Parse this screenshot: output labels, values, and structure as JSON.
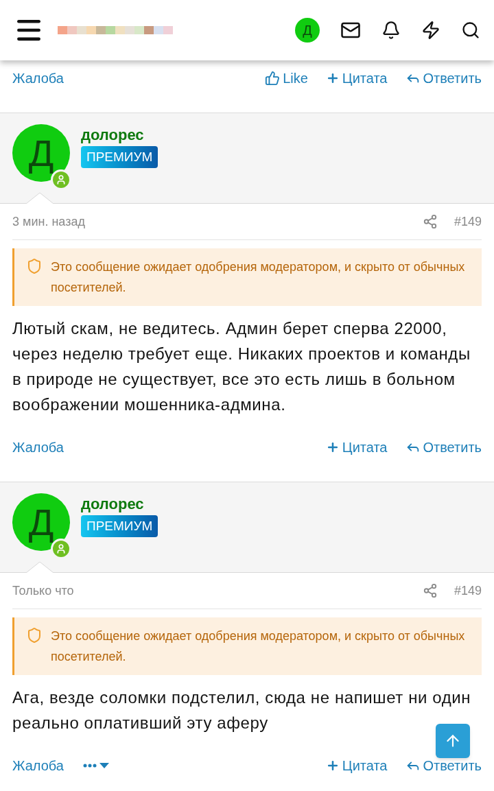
{
  "header": {
    "avatar_letter": "Д"
  },
  "top_actions": [
    {
      "kind": "report",
      "label": "Жалоба"
    },
    {
      "kind": "like",
      "label": "Like"
    },
    {
      "kind": "quote",
      "label": "Цитата"
    },
    {
      "kind": "reply",
      "label": "Ответить"
    }
  ],
  "posts": [
    {
      "author": "долорес",
      "badge": "ПРЕМИУМ",
      "avatar_letter": "Д",
      "time": "3 мин. назад",
      "number": "#149",
      "notice": "Это сообщение ожидает одобрения модератором, и скрыто от обычных посетителей.",
      "body": "Лютый скам, не ведитесь. Админ берет сперва 22000, через неделю требует еще. Никаких проектов и команды в природе не существует, все это есть лишь в больном воображении мошенника-админа.",
      "actions": [
        {
          "kind": "report",
          "label": "Жалоба"
        },
        {
          "kind": "quote",
          "label": "Цитата"
        },
        {
          "kind": "reply",
          "label": "Ответить"
        }
      ]
    },
    {
      "author": "долорес",
      "badge": "ПРЕМИУМ",
      "avatar_letter": "Д",
      "time": "Только что",
      "number": "#149",
      "notice": "Это сообщение ожидает одобрения модератором, и скрыто от обычных посетителей.",
      "body": "Ага, везде соломки подстелил, сюда не напишет ни один реально оплативший эту аферу",
      "actions": [
        {
          "kind": "report",
          "label": "Жалоба"
        },
        {
          "kind": "more"
        },
        {
          "kind": "quote",
          "label": "Цитата"
        },
        {
          "kind": "reply",
          "label": "Ответить"
        }
      ]
    }
  ]
}
